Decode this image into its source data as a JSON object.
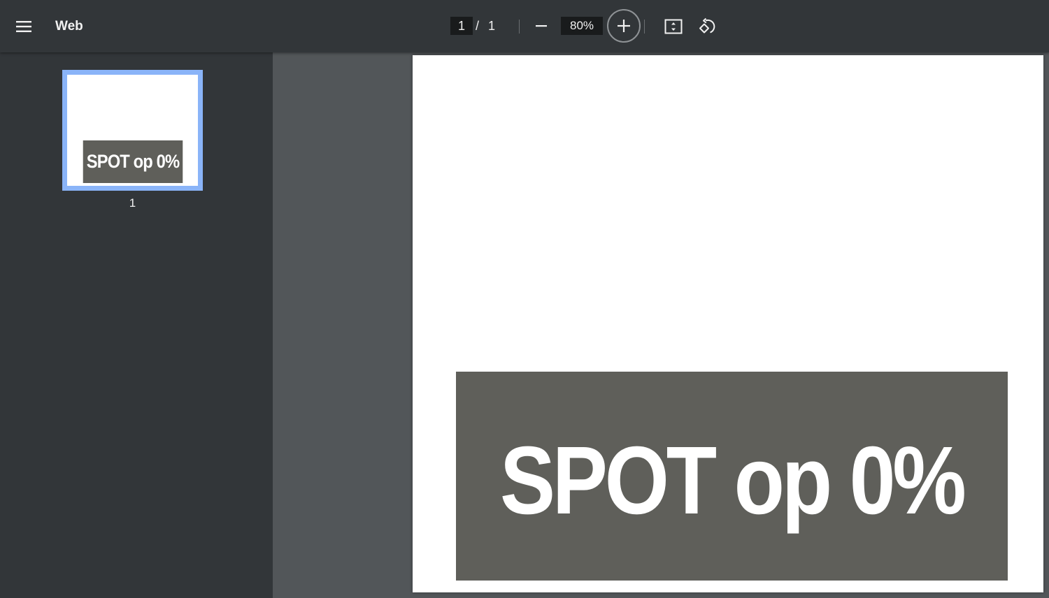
{
  "toolbar": {
    "title": "Web",
    "page_current": "1",
    "page_separator": "/",
    "page_total": "1",
    "zoom": "80%"
  },
  "icons": {
    "menu": "hamburger-menu-icon",
    "zoom_out": "minus-icon",
    "zoom_in": "plus-icon",
    "fit": "fit-to-page-icon",
    "rotate": "rotate-counterclockwise-icon"
  },
  "sidebar": {
    "thumbnails": [
      {
        "banner_text": "SPOT op 0%",
        "page_number": "1"
      }
    ]
  },
  "document": {
    "banner_text": "SPOT op 0%"
  },
  "colors": {
    "toolbar_bg": "#323639",
    "viewer_bg": "#525659",
    "thumb_selected_border": "#8ab4f8",
    "banner_bg": "#5f5f5a"
  }
}
